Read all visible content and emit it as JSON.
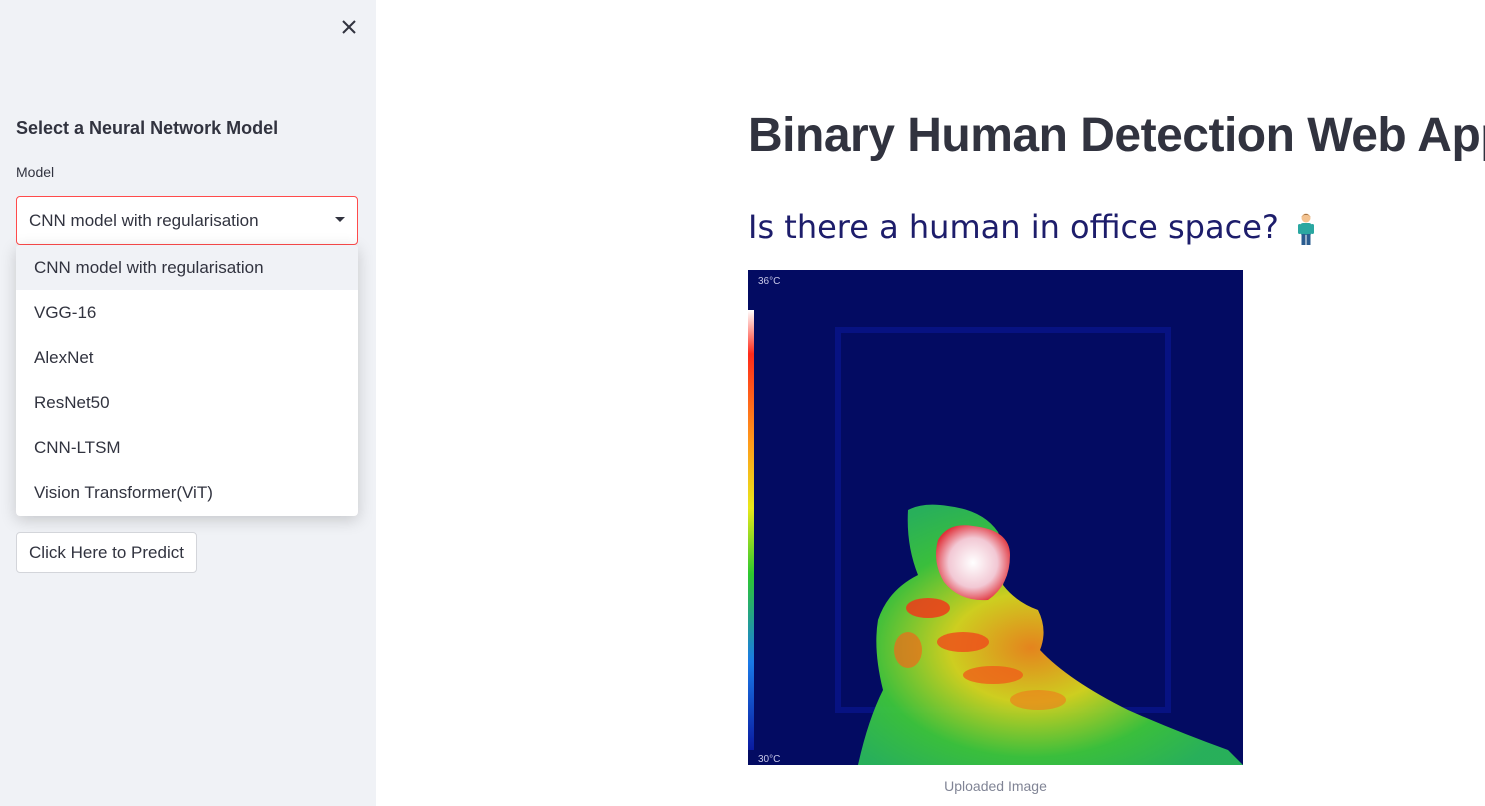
{
  "sidebar": {
    "heading": "Select a Neural Network Model",
    "model_label": "Model",
    "selected_value": "CNN model with regularisation",
    "options": [
      "CNN model with regularisation",
      "VGG-16",
      "AlexNet",
      "ResNet50",
      "CNN-LTSM",
      "Vision Transformer(ViT)"
    ],
    "predict_button": "Click Here to Predict",
    "close_icon": "close-icon"
  },
  "main": {
    "title": "Binary Human Detection Web App",
    "subtitle": "Is there a human in office space?",
    "subtitle_icon": "standing-person-icon",
    "image": {
      "top_temp": "36°C",
      "bottom_temp": "30°C",
      "caption": "Uploaded Image"
    }
  },
  "colors": {
    "accent": "#ff4b4b",
    "sidebar_bg": "#f0f2f6",
    "text": "#31333f",
    "subtitle": "#1d1d6b"
  }
}
